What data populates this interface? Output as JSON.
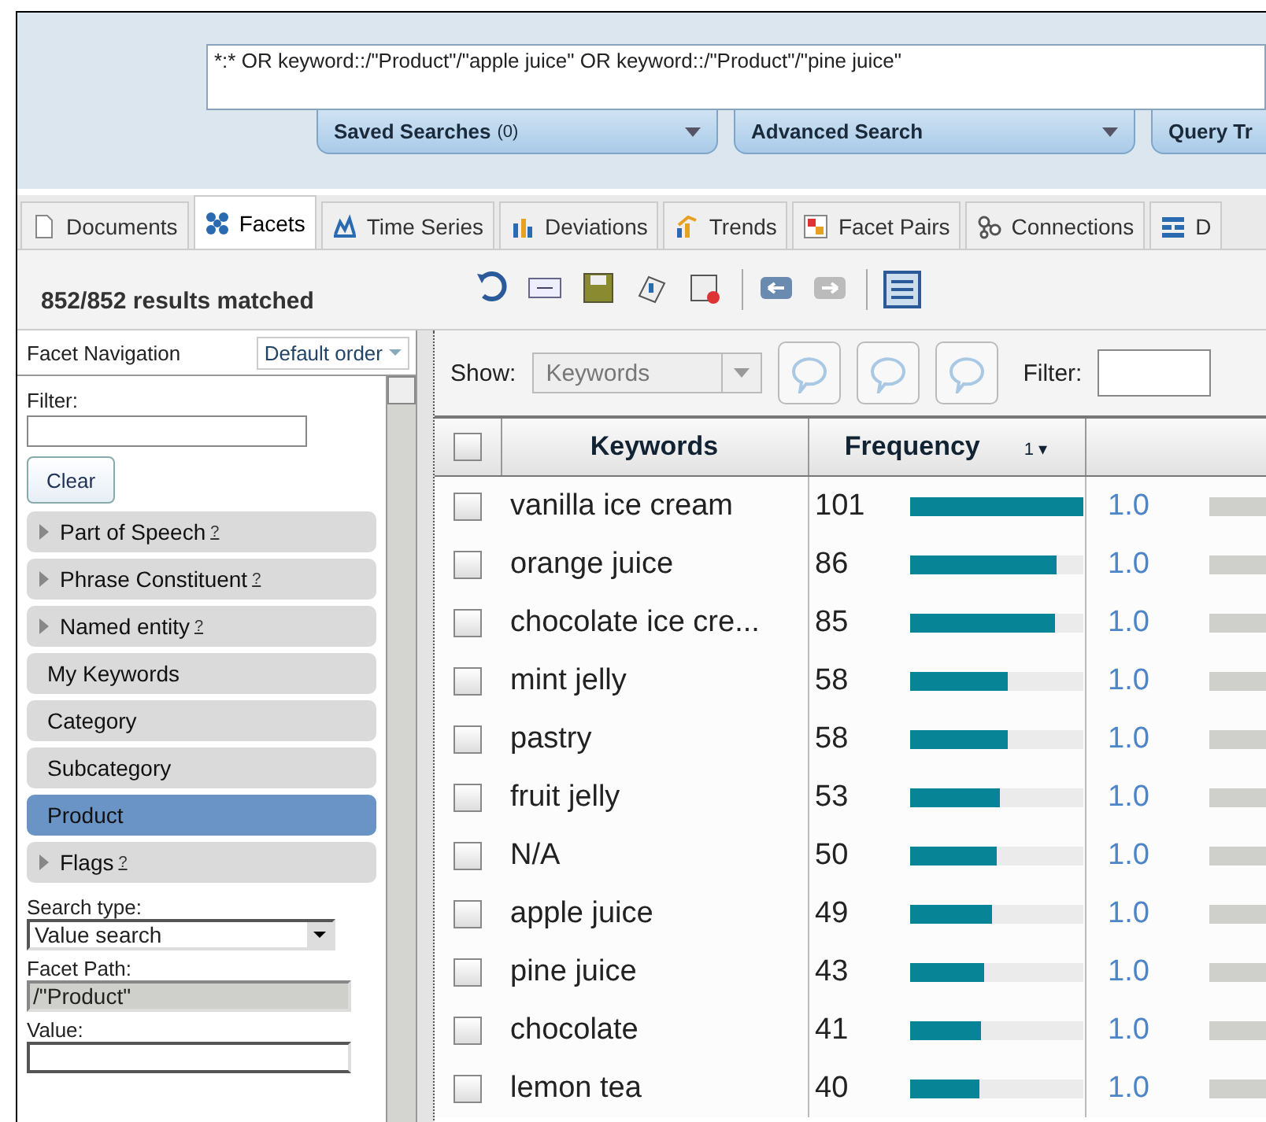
{
  "query": {
    "value": "*:* OR keyword::/\"Product\"/\"apple juice\" OR keyword::/\"Product\"/\"pine juice\""
  },
  "search_panels": [
    {
      "label": "Saved Searches",
      "count": "(0)",
      "caret": true
    },
    {
      "label": "Advanced Search",
      "caret": true
    },
    {
      "label": "Query Tr"
    }
  ],
  "tabs": [
    {
      "label": "Documents",
      "selected": false
    },
    {
      "label": "Facets",
      "selected": true
    },
    {
      "label": "Time Series",
      "selected": false
    },
    {
      "label": "Deviations",
      "selected": false
    },
    {
      "label": "Trends",
      "selected": false
    },
    {
      "label": "Facet Pairs",
      "selected": false
    },
    {
      "label": "Connections",
      "selected": false
    },
    {
      "label": "D",
      "selected": false
    }
  ],
  "results_matched": "852/852 results matched",
  "facet_navigation": {
    "title": "Facet Navigation",
    "order": "Default order",
    "filter_label": "Filter:",
    "clear": "Clear",
    "items": [
      {
        "label": "Part of Speech",
        "help": "?",
        "expandable": true,
        "selected": false
      },
      {
        "label": "Phrase Constituent",
        "help": "?",
        "expandable": true,
        "selected": false
      },
      {
        "label": "Named entity",
        "help": "?",
        "expandable": true,
        "selected": false
      },
      {
        "label": "My Keywords",
        "expandable": false,
        "selected": false
      },
      {
        "label": "Category",
        "expandable": false,
        "selected": false
      },
      {
        "label": "Subcategory",
        "expandable": false,
        "selected": false
      },
      {
        "label": "Product",
        "expandable": false,
        "selected": true
      },
      {
        "label": "Flags",
        "help": "?",
        "expandable": true,
        "selected": false
      }
    ],
    "search_type_label": "Search type:",
    "search_type": "Value search",
    "facet_path_label": "Facet Path:",
    "facet_path": "/\"Product\"",
    "value_label": "Value:"
  },
  "show": {
    "label": "Show:",
    "value": "Keywords",
    "filter_label": "Filter:"
  },
  "table": {
    "select_all": {
      "checked": false
    },
    "columns": [
      "Keywords",
      "Frequency"
    ],
    "sort_index": "1",
    "sort_arrow": "▾",
    "rows": [
      {
        "keyword": "vanilla ice cream",
        "frequency": "101",
        "level": 1.0,
        "score": "1.0",
        "checked": false
      },
      {
        "keyword": "orange juice",
        "frequency": "86",
        "level": 0.85,
        "score": "1.0",
        "checked": false
      },
      {
        "keyword": "chocolate ice cre...",
        "frequency": "85",
        "level": 0.84,
        "score": "1.0",
        "checked": false
      },
      {
        "keyword": "mint jelly",
        "frequency": "58",
        "level": 0.57,
        "score": "1.0",
        "checked": false
      },
      {
        "keyword": "pastry",
        "frequency": "58",
        "level": 0.57,
        "score": "1.0",
        "checked": false
      },
      {
        "keyword": "fruit jelly",
        "frequency": "53",
        "level": 0.52,
        "score": "1.0",
        "checked": false
      },
      {
        "keyword": "N/A",
        "frequency": "50",
        "level": 0.5,
        "score": "1.0",
        "checked": false
      },
      {
        "keyword": "apple juice",
        "frequency": "49",
        "level": 0.48,
        "score": "1.0",
        "checked": false
      },
      {
        "keyword": "pine juice",
        "frequency": "43",
        "level": 0.43,
        "score": "1.0",
        "checked": false
      },
      {
        "keyword": "chocolate",
        "frequency": "41",
        "level": 0.41,
        "score": "1.0",
        "checked": false
      },
      {
        "keyword": "lemon tea",
        "frequency": "40",
        "level": 0.4,
        "score": "1.0",
        "checked": false
      }
    ]
  }
}
